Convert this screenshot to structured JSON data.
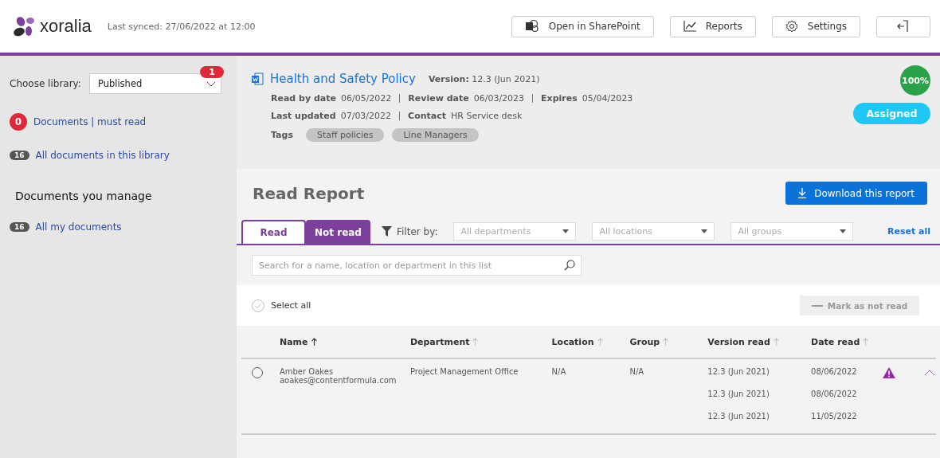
{
  "header": {
    "logo_text": "xoralia",
    "last_synced": "Last synced: 27/06/2022 at 12:00",
    "buttons": [
      {
        "kind": "sharepoint",
        "label": "Open in SharePoint"
      },
      {
        "kind": "reports",
        "label": "Reports"
      },
      {
        "kind": "settings",
        "label": "Settings"
      },
      {
        "kind": "logout"
      }
    ]
  },
  "sidebar": {
    "library_label": "Choose library:",
    "library_value": "Published",
    "library_badge": "1",
    "links": [
      {
        "count": "0",
        "label": "Documents | must read",
        "kind": "alert"
      },
      {
        "count": "16",
        "label": "All documents in this library",
        "kind": "count"
      }
    ],
    "section_title": "Documents you manage",
    "manage_links": [
      {
        "count": "16",
        "label": "All my documents",
        "kind": "count"
      }
    ]
  },
  "document": {
    "title": "Health and Safety Policy",
    "version_label": "Version:",
    "version_value": "12.3 (Jun 2021)",
    "meta": [
      [
        {
          "label": "Read by date",
          "value": "06/05/2022"
        },
        {
          "label": "Review date",
          "value": "06/03/2023"
        },
        {
          "label": "Expires",
          "value": "05/04/2023"
        }
      ],
      [
        {
          "label": "Last updated",
          "value": "07/03/2022"
        },
        {
          "label": "Contact",
          "value": "HR Service desk"
        }
      ]
    ],
    "tags_label": "Tags",
    "tags": [
      "Staff policies",
      "Line Managers"
    ],
    "progress": "100%",
    "status": "Assigned"
  },
  "report": {
    "title": "Read Report",
    "download_label": "Download this report",
    "tabs": [
      {
        "label": "Read",
        "selected": false
      },
      {
        "label": "Not read",
        "selected": true
      }
    ],
    "filter_label": "Filter by:",
    "filters": [
      {
        "placeholder": "All departments"
      },
      {
        "placeholder": "All locations"
      },
      {
        "placeholder": "All groups"
      }
    ],
    "reset_label": "Reset all",
    "search": {
      "placeholder": "Search for a name, location or department in this list"
    },
    "select_all": "Select all",
    "select_all_checked": false,
    "mark_button": {
      "label": "Mark as not read",
      "disabled": true
    },
    "columns": [
      {
        "label": "Name",
        "sorted": true
      },
      {
        "label": "Department",
        "sorted": false
      },
      {
        "label": "Location",
        "sorted": false
      },
      {
        "label": "Group",
        "sorted": false
      },
      {
        "label": "Version read",
        "sorted": false
      },
      {
        "label": "Date read",
        "sorted": false
      }
    ],
    "rows": [
      {
        "selected": false,
        "name": "Amber Oakes",
        "email": "aoakes@contentformula.com",
        "department": "Project Management Office",
        "location": "N/A",
        "group": "N/A",
        "warning": true,
        "expanded": true,
        "reads": [
          {
            "version": "12.3 (Jun 2021)",
            "date": "08/06/2022"
          },
          {
            "version": "12.3 (Jun 2021)",
            "date": "08/06/2022"
          },
          {
            "version": "12.3 (Jun 2021)",
            "date": "11/05/2022"
          }
        ]
      }
    ]
  }
}
